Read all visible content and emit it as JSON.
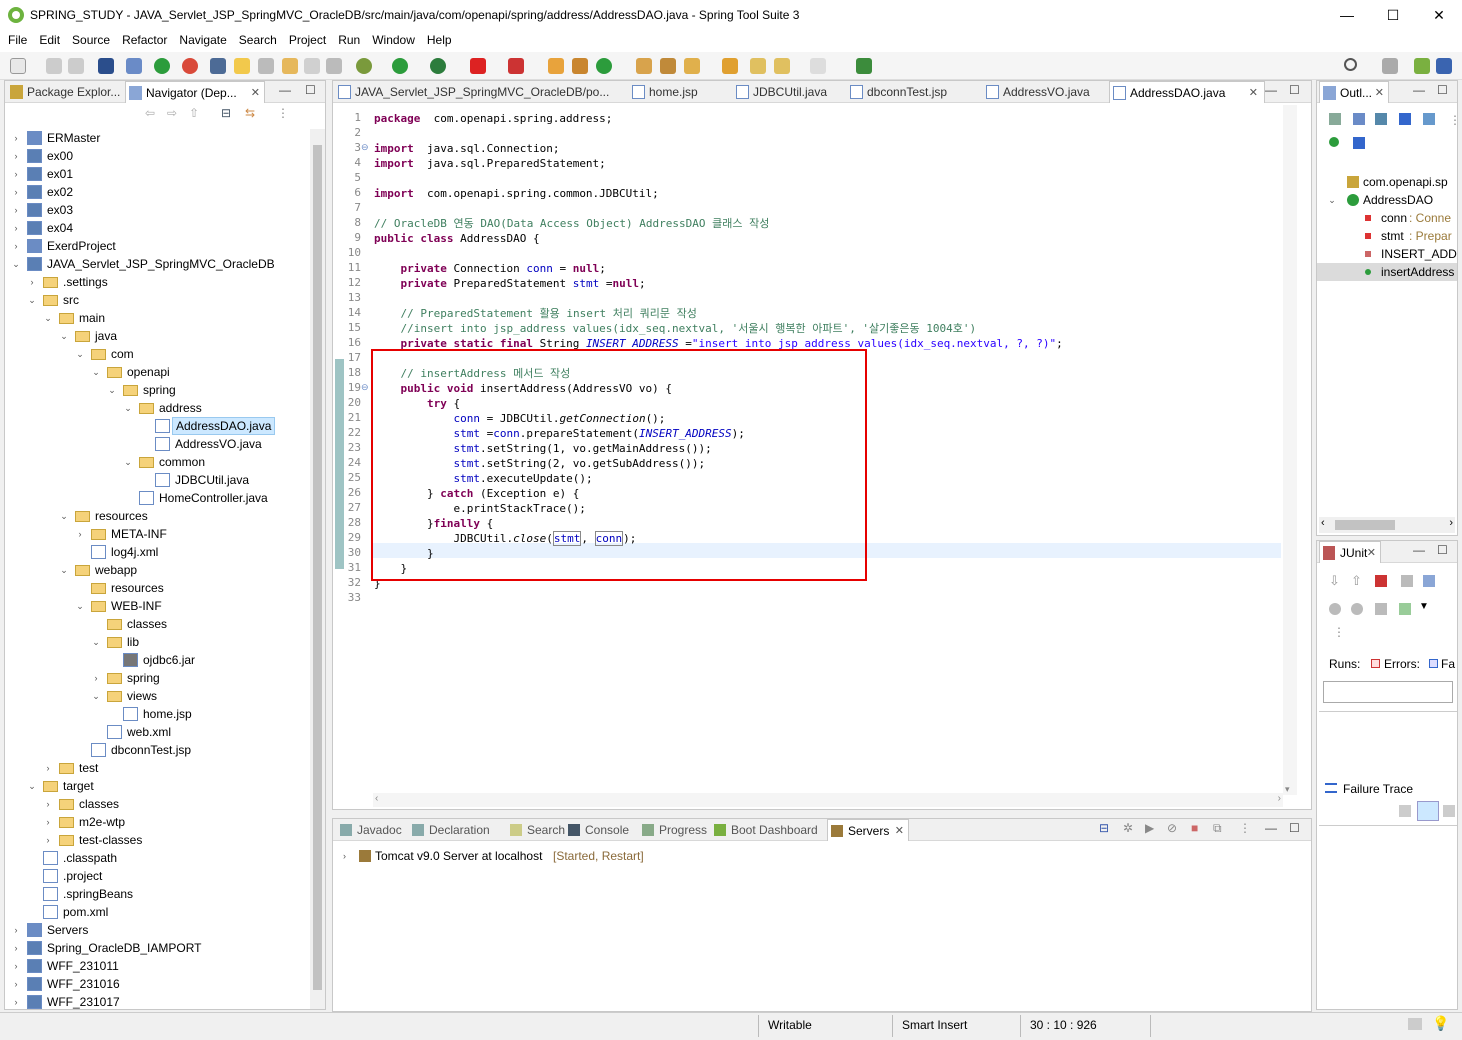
{
  "window": {
    "title": "SPRING_STUDY - JAVA_Servlet_JSP_SpringMVC_OracleDB/src/main/java/com/openapi/spring/address/AddressDAO.java - Spring Tool Suite 3",
    "minimize": "—",
    "maximize": "☐",
    "close": "✕"
  },
  "menu": [
    "File",
    "Edit",
    "Source",
    "Refactor",
    "Navigate",
    "Search",
    "Project",
    "Run",
    "Window",
    "Help"
  ],
  "left_panel": {
    "tabs": [
      {
        "label": "Package Explor...",
        "icon": "package-explorer-icon"
      },
      {
        "label": "Navigator (Dep...",
        "icon": "navigator-icon"
      }
    ],
    "tree": [
      {
        "label": "ERMaster",
        "level": 0,
        "expanded": false,
        "icon": "project-icon"
      },
      {
        "label": "ex00",
        "level": 0,
        "expanded": false,
        "icon": "maven-project-icon"
      },
      {
        "label": "ex01",
        "level": 0,
        "expanded": false,
        "icon": "maven-project-icon"
      },
      {
        "label": "ex02",
        "level": 0,
        "expanded": false,
        "icon": "maven-project-icon"
      },
      {
        "label": "ex03",
        "level": 0,
        "expanded": false,
        "icon": "maven-project-icon"
      },
      {
        "label": "ex04",
        "level": 0,
        "expanded": false,
        "icon": "maven-project-icon"
      },
      {
        "label": "ExerdProject",
        "level": 0,
        "expanded": false,
        "icon": "project-icon"
      },
      {
        "label": "JAVA_Servlet_JSP_SpringMVC_OracleDB",
        "level": 0,
        "expanded": true,
        "icon": "maven-project-icon"
      },
      {
        "label": ".settings",
        "level": 1,
        "expanded": false,
        "icon": "folder-icon"
      },
      {
        "label": "src",
        "level": 1,
        "expanded": true,
        "icon": "folder-icon"
      },
      {
        "label": "main",
        "level": 2,
        "expanded": true,
        "icon": "folder-icon"
      },
      {
        "label": "java",
        "level": 3,
        "expanded": true,
        "icon": "folder-icon"
      },
      {
        "label": "com",
        "level": 4,
        "expanded": true,
        "icon": "folder-icon"
      },
      {
        "label": "openapi",
        "level": 5,
        "expanded": true,
        "icon": "folder-icon"
      },
      {
        "label": "spring",
        "level": 6,
        "expanded": true,
        "icon": "folder-icon"
      },
      {
        "label": "address",
        "level": 7,
        "expanded": true,
        "icon": "folder-icon"
      },
      {
        "label": "AddressDAO.java",
        "level": 8,
        "leaf": true,
        "icon": "java-file-icon",
        "selected": true
      },
      {
        "label": "AddressVO.java",
        "level": 8,
        "leaf": true,
        "icon": "java-file-icon"
      },
      {
        "label": "common",
        "level": 7,
        "expanded": true,
        "icon": "folder-icon"
      },
      {
        "label": "JDBCUtil.java",
        "level": 8,
        "leaf": true,
        "icon": "java-file-icon"
      },
      {
        "label": "HomeController.java",
        "level": 7,
        "leaf": true,
        "icon": "java-file-icon"
      },
      {
        "label": "resources",
        "level": 3,
        "expanded": true,
        "icon": "folder-icon"
      },
      {
        "label": "META-INF",
        "level": 4,
        "expanded": false,
        "icon": "folder-icon"
      },
      {
        "label": "log4j.xml",
        "level": 4,
        "leaf": true,
        "icon": "xml-file-icon"
      },
      {
        "label": "webapp",
        "level": 3,
        "expanded": true,
        "icon": "folder-icon"
      },
      {
        "label": "resources",
        "level": 4,
        "leaf": true,
        "icon": "folder-icon"
      },
      {
        "label": "WEB-INF",
        "level": 4,
        "expanded": true,
        "icon": "folder-icon"
      },
      {
        "label": "classes",
        "level": 5,
        "leaf": true,
        "icon": "folder-icon"
      },
      {
        "label": "lib",
        "level": 5,
        "expanded": true,
        "icon": "folder-icon"
      },
      {
        "label": "ojdbc6.jar",
        "level": 6,
        "leaf": true,
        "icon": "jar-icon"
      },
      {
        "label": "spring",
        "level": 5,
        "expanded": false,
        "icon": "folder-icon"
      },
      {
        "label": "views",
        "level": 5,
        "expanded": true,
        "icon": "folder-icon"
      },
      {
        "label": "home.jsp",
        "level": 6,
        "leaf": true,
        "icon": "jsp-file-icon"
      },
      {
        "label": "web.xml",
        "level": 5,
        "leaf": true,
        "icon": "xml-file-icon"
      },
      {
        "label": "dbconnTest.jsp",
        "level": 4,
        "leaf": true,
        "icon": "jsp-file-icon"
      },
      {
        "label": "test",
        "level": 2,
        "expanded": false,
        "icon": "folder-icon"
      },
      {
        "label": "target",
        "level": 1,
        "expanded": true,
        "icon": "folder-icon"
      },
      {
        "label": "classes",
        "level": 2,
        "expanded": false,
        "icon": "folder-icon"
      },
      {
        "label": "m2e-wtp",
        "level": 2,
        "expanded": false,
        "icon": "folder-icon"
      },
      {
        "label": "test-classes",
        "level": 2,
        "expanded": false,
        "icon": "folder-icon"
      },
      {
        "label": ".classpath",
        "level": 1,
        "leaf": true,
        "icon": "xml-file-icon"
      },
      {
        "label": ".project",
        "level": 1,
        "leaf": true,
        "icon": "xml-file-icon"
      },
      {
        "label": ".springBeans",
        "level": 1,
        "leaf": true,
        "icon": "file-icon"
      },
      {
        "label": "pom.xml",
        "level": 1,
        "leaf": true,
        "icon": "maven-file-icon"
      },
      {
        "label": "Servers",
        "level": 0,
        "expanded": false,
        "icon": "project-icon"
      },
      {
        "label": "Spring_OracleDB_IAMPORT",
        "level": 0,
        "expanded": false,
        "icon": "maven-project-icon"
      },
      {
        "label": "WFF_231011",
        "level": 0,
        "expanded": false,
        "icon": "maven-project-icon"
      },
      {
        "label": "WFF_231016",
        "level": 0,
        "expanded": false,
        "icon": "maven-project-icon"
      },
      {
        "label": "WFF_231017",
        "level": 0,
        "expanded": false,
        "icon": "maven-project-icon"
      }
    ]
  },
  "editor": {
    "tabs": [
      {
        "label": "JAVA_Servlet_JSP_SpringMVC_OracleDB/po...",
        "icon": "maven-file-icon"
      },
      {
        "label": "home.jsp",
        "icon": "jsp-file-icon"
      },
      {
        "label": "JDBCUtil.java",
        "icon": "java-file-icon"
      },
      {
        "label": "dbconnTest.jsp",
        "icon": "jsp-file-icon"
      },
      {
        "label": "AddressVO.java",
        "icon": "java-file-icon"
      },
      {
        "label": "AddressDAO.java",
        "icon": "java-file-icon",
        "active": true
      }
    ],
    "current_line": 30,
    "lines": [
      {
        "n": "1",
        "tokens": [
          [
            "kw",
            "package"
          ],
          [
            "",
            "  com.openapi.spring.address;"
          ]
        ]
      },
      {
        "n": "2",
        "tokens": []
      },
      {
        "n": "3",
        "fold": true,
        "tokens": [
          [
            "kw",
            "import"
          ],
          [
            "",
            "  java.sql.Connection;"
          ]
        ]
      },
      {
        "n": "4",
        "tokens": [
          [
            "kw",
            "import"
          ],
          [
            "",
            "  java.sql.PreparedStatement;"
          ]
        ]
      },
      {
        "n": "5",
        "tokens": []
      },
      {
        "n": "6",
        "tokens": [
          [
            "kw",
            "import"
          ],
          [
            "",
            "  com.openapi.spring.common.JDBCUtil;"
          ]
        ]
      },
      {
        "n": "7",
        "tokens": []
      },
      {
        "n": "8",
        "tokens": [
          [
            "cm",
            "// OracleDB 연동 DAO(Data Access Object) AddressDAO 클래스 작성"
          ]
        ]
      },
      {
        "n": "9",
        "tokens": [
          [
            "kw",
            "public class"
          ],
          [
            "",
            " AddressDAO {"
          ]
        ]
      },
      {
        "n": "10",
        "tokens": []
      },
      {
        "n": "11",
        "tokens": [
          [
            "",
            "    "
          ],
          [
            "kw",
            "private"
          ],
          [
            "",
            " Connection "
          ],
          [
            "fd",
            "conn"
          ],
          [
            "",
            " = "
          ],
          [
            "kw",
            "null"
          ],
          [
            "",
            ";"
          ]
        ]
      },
      {
        "n": "12",
        "tokens": [
          [
            "",
            "    "
          ],
          [
            "kw",
            "private"
          ],
          [
            "",
            " PreparedStatement "
          ],
          [
            "fd",
            "stmt"
          ],
          [
            "",
            " ="
          ],
          [
            "kw",
            "null"
          ],
          [
            "",
            ";"
          ]
        ]
      },
      {
        "n": "13",
        "tokens": []
      },
      {
        "n": "14",
        "tokens": [
          [
            "cm",
            "    // PreparedStatement 활용 insert 처리 쿼리문 작성"
          ]
        ]
      },
      {
        "n": "15",
        "tokens": [
          [
            "cm",
            "    //insert into jsp_address values(idx_seq.nextval, '서울시 행복한 아파트', '살기좋은동 1004호')"
          ]
        ]
      },
      {
        "n": "16",
        "tokens": [
          [
            "",
            "    "
          ],
          [
            "kw",
            "private static final"
          ],
          [
            "",
            " String "
          ],
          [
            "sfd",
            "INSERT_ADDRESS"
          ],
          [
            "",
            " ="
          ],
          [
            "st",
            "\"insert into jsp_address values(idx_seq.nextval, ?, ?)\""
          ],
          [
            "",
            ";"
          ]
        ]
      },
      {
        "n": "17",
        "tokens": []
      },
      {
        "n": "18",
        "tokens": [
          [
            "cm",
            "    // insertAddress 메서드 작성"
          ]
        ]
      },
      {
        "n": "19",
        "fold": true,
        "tokens": [
          [
            "",
            "    "
          ],
          [
            "kw",
            "public void"
          ],
          [
            "",
            " insertAddress(AddressVO vo) {"
          ]
        ]
      },
      {
        "n": "20",
        "tokens": [
          [
            "",
            "        "
          ],
          [
            "kw",
            "try"
          ],
          [
            "",
            " {"
          ]
        ]
      },
      {
        "n": "21",
        "tokens": [
          [
            "",
            "            "
          ],
          [
            "fd",
            "conn"
          ],
          [
            "",
            " = JDBCUtil."
          ],
          [
            "it",
            "getConnection"
          ],
          [
            "",
            "();"
          ]
        ]
      },
      {
        "n": "22",
        "tokens": [
          [
            "",
            "            "
          ],
          [
            "fd",
            "stmt"
          ],
          [
            "",
            " ="
          ],
          [
            "fd",
            "conn"
          ],
          [
            "",
            ".prepareStatement("
          ],
          [
            "sfd",
            "INSERT_ADDRESS"
          ],
          [
            "",
            ");"
          ]
        ]
      },
      {
        "n": "23",
        "tokens": [
          [
            "",
            "            "
          ],
          [
            "fd",
            "stmt"
          ],
          [
            "",
            ".setString(1, vo.getMainAddress());"
          ]
        ]
      },
      {
        "n": "24",
        "tokens": [
          [
            "",
            "            "
          ],
          [
            "fd",
            "stmt"
          ],
          [
            "",
            ".setString(2, vo.getSubAddress());"
          ]
        ]
      },
      {
        "n": "25",
        "tokens": [
          [
            "",
            "            "
          ],
          [
            "fd",
            "stmt"
          ],
          [
            "",
            ".executeUpdate();"
          ]
        ]
      },
      {
        "n": "26",
        "tokens": [
          [
            "",
            "        } "
          ],
          [
            "kw",
            "catch"
          ],
          [
            "",
            " (Exception e) {"
          ]
        ]
      },
      {
        "n": "27",
        "tokens": [
          [
            "",
            "            e.printStackTrace();"
          ]
        ]
      },
      {
        "n": "28",
        "tokens": [
          [
            "",
            "        }"
          ],
          [
            "kw",
            "finally"
          ],
          [
            "",
            " {"
          ]
        ]
      },
      {
        "n": "29",
        "tokens": [
          [
            "",
            "            JDBCUtil."
          ],
          [
            "it",
            "close"
          ],
          [
            "",
            "("
          ],
          [
            "fd",
            "stmt"
          ],
          [
            "",
            ", "
          ],
          [
            "fd",
            "conn"
          ],
          [
            "",
            ");"
          ]
        ]
      },
      {
        "n": "30",
        "tokens": [
          [
            "",
            "        }"
          ]
        ]
      },
      {
        "n": "31",
        "tokens": [
          [
            "",
            "    }"
          ]
        ]
      },
      {
        "n": "32",
        "tokens": [
          [
            "",
            "}"
          ]
        ]
      },
      {
        "n": "33",
        "tokens": []
      }
    ]
  },
  "outline": {
    "tab": "Outl...",
    "items": [
      {
        "label": "com.openapi.sp",
        "icon": "package-icon",
        "level": 0
      },
      {
        "label": "AddressDAO",
        "icon": "class-icon",
        "level": 0,
        "expanded": true
      },
      {
        "label": "conn",
        "type": " : Conne",
        "icon": "private-field-icon",
        "level": 1
      },
      {
        "label": "stmt",
        "type": " : Prepar",
        "icon": "private-field-icon",
        "level": 1
      },
      {
        "label": "INSERT_ADD",
        "type": "",
        "icon": "static-final-field-icon",
        "level": 1
      },
      {
        "label": "insertAddress",
        "type": "",
        "icon": "public-method-icon",
        "level": 1,
        "selected": true
      }
    ]
  },
  "junit": {
    "tab": "JUnit",
    "runs_label": "Runs:",
    "errors_label": "Errors:",
    "failures_label": "Fa",
    "failure_trace": "Failure Trace"
  },
  "bottom": {
    "tabs": [
      {
        "label": "Javadoc",
        "icon": "javadoc-icon"
      },
      {
        "label": "Declaration",
        "icon": "declaration-icon"
      },
      {
        "label": "Search",
        "icon": "search-icon"
      },
      {
        "label": "Console",
        "icon": "console-icon"
      },
      {
        "label": "Progress",
        "icon": "progress-icon"
      },
      {
        "label": "Boot Dashboard",
        "icon": "boot-dashboard-icon"
      },
      {
        "label": "Servers",
        "icon": "servers-icon",
        "active": true
      }
    ],
    "server": {
      "name": "Tomcat v9.0 Server at localhost",
      "state": "[Started, Restart]"
    }
  },
  "status": {
    "writable": "Writable",
    "insert_mode": "Smart Insert",
    "position": "30 : 10 : 926"
  },
  "colors": {
    "highlight_box": "#e60000",
    "keyword": "#7f0055",
    "comment": "#3f7f5f",
    "string": "#2a00ff",
    "field": "#0000c0",
    "selection": "#cce8ff"
  }
}
